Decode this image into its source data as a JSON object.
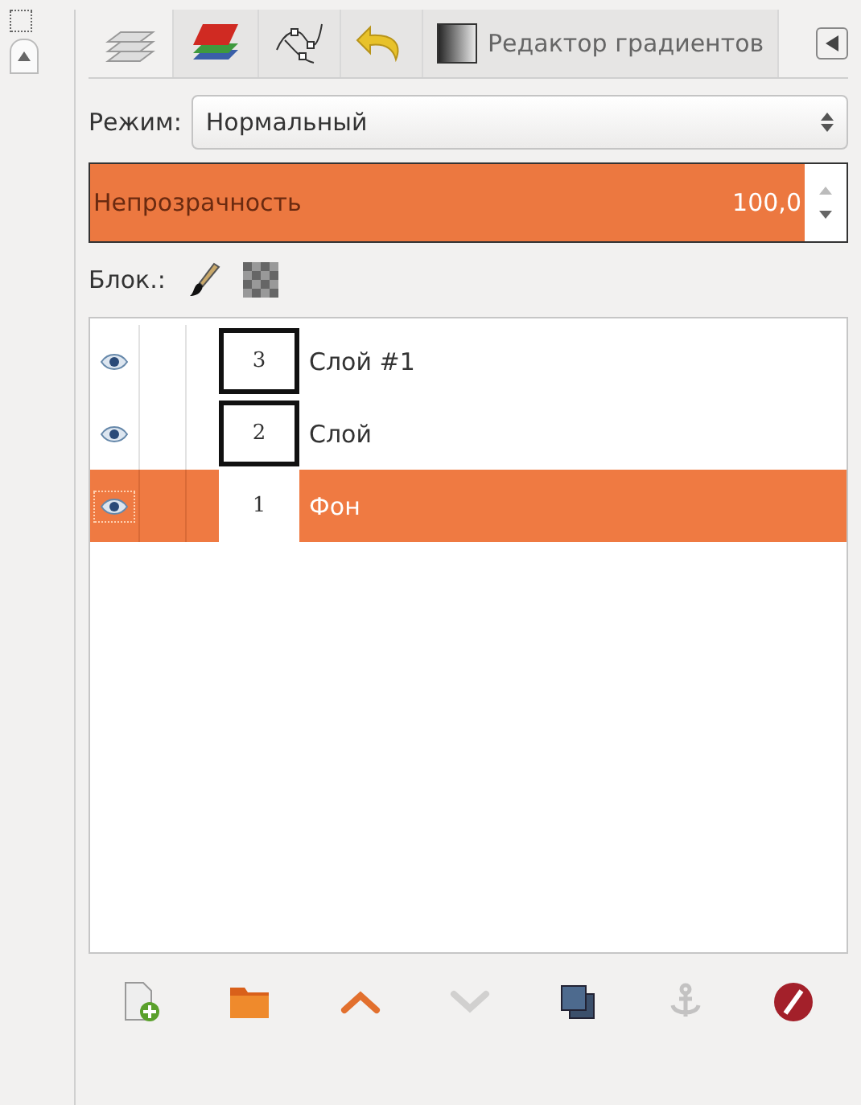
{
  "tabs": [
    {
      "kind": "layers",
      "selected": true
    },
    {
      "kind": "channels",
      "selected": false
    },
    {
      "kind": "paths",
      "selected": false
    },
    {
      "kind": "undo",
      "selected": false
    },
    {
      "kind": "gradient",
      "label": "Редактор градиентов",
      "selected": false
    }
  ],
  "mode": {
    "label": "Режим:",
    "value": "Нормальный"
  },
  "opacity": {
    "label": "Непрозрачность",
    "value": "100,0",
    "level": 1.0
  },
  "lock": {
    "label": "Блок.:"
  },
  "layers": [
    {
      "thumb": "3",
      "name": "Слой #1",
      "visible": true,
      "selected": false
    },
    {
      "thumb": "2",
      "name": "Слой",
      "visible": true,
      "selected": false
    },
    {
      "thumb": "1",
      "name": "Фон",
      "visible": true,
      "selected": true
    }
  ],
  "buttons": [
    {
      "kind": "new",
      "disabled": false
    },
    {
      "kind": "group",
      "disabled": false
    },
    {
      "kind": "raise",
      "disabled": false
    },
    {
      "kind": "lower",
      "disabled": true
    },
    {
      "kind": "duplicate",
      "disabled": false
    },
    {
      "kind": "anchor",
      "disabled": true
    },
    {
      "kind": "delete",
      "disabled": false
    }
  ]
}
